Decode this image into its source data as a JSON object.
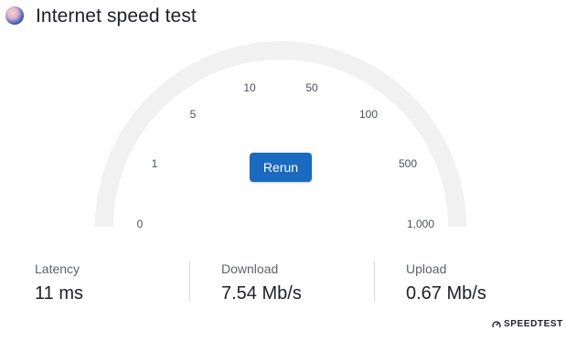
{
  "header": {
    "title": "Internet speed test",
    "logo_icon": "speed-test-globe-icon"
  },
  "gauge": {
    "scale": "logarithmic",
    "track_color": "#f1f1f1",
    "ticks": [
      "0",
      "1",
      "5",
      "10",
      "50",
      "100",
      "500",
      "1,000"
    ]
  },
  "actions": {
    "rerun_label": "Rerun",
    "accent_color": "#1a6ac1"
  },
  "results": {
    "latency": {
      "label": "Latency",
      "value": "11 ms"
    },
    "download": {
      "label": "Download",
      "value": "7.54 Mb/s"
    },
    "upload": {
      "label": "Upload",
      "value": "0.67 Mb/s"
    }
  },
  "footer": {
    "brand": "SPEEDTEST",
    "brand_icon": "speedtest-gauge-icon"
  }
}
